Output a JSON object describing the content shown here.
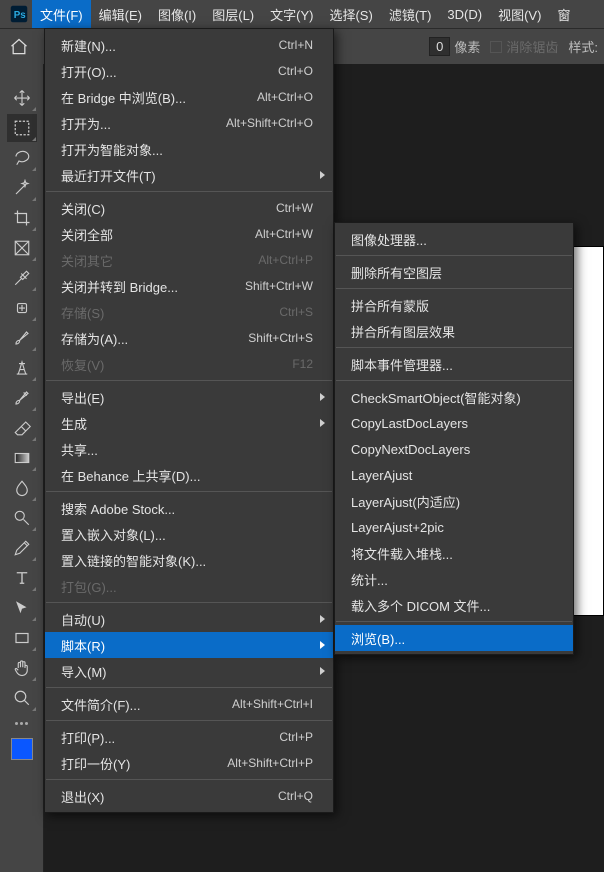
{
  "menubar": {
    "items": [
      "文件(F)",
      "编辑(E)",
      "图像(I)",
      "图层(L)",
      "文字(Y)",
      "选择(S)",
      "滤镜(T)",
      "3D(D)",
      "视图(V)",
      "窗"
    ]
  },
  "optbar": {
    "num": "0",
    "unit": "像素",
    "anti_alias": "消除锯齿",
    "style": "样式:"
  },
  "tools": [
    "move-tool",
    "marquee-tool",
    "lasso-tool",
    "magic-wand-tool",
    "crop-tool",
    "frame-tool",
    "eyedropper-tool",
    "healing-brush-tool",
    "brush-tool",
    "clone-stamp-tool",
    "history-brush-tool",
    "eraser-tool",
    "gradient-tool",
    "blur-tool",
    "dodge-tool",
    "pen-tool",
    "type-tool",
    "path-selection-tool",
    "rectangle-tool",
    "hand-tool",
    "zoom-tool"
  ],
  "swatch_color": "#0a57ff",
  "file_menu": [
    {
      "label": "新建(N)...",
      "shortcut": "Ctrl+N"
    },
    {
      "label": "打开(O)...",
      "shortcut": "Ctrl+O"
    },
    {
      "label": "在 Bridge 中浏览(B)...",
      "shortcut": "Alt+Ctrl+O"
    },
    {
      "label": "打开为...",
      "shortcut": "Alt+Shift+Ctrl+O"
    },
    {
      "label": "打开为智能对象..."
    },
    {
      "label": "最近打开文件(T)",
      "sub": true
    },
    {
      "sep": true
    },
    {
      "label": "关闭(C)",
      "shortcut": "Ctrl+W"
    },
    {
      "label": "关闭全部",
      "shortcut": "Alt+Ctrl+W"
    },
    {
      "label": "关闭其它",
      "shortcut": "Alt+Ctrl+P",
      "disabled": true
    },
    {
      "label": "关闭并转到 Bridge...",
      "shortcut": "Shift+Ctrl+W"
    },
    {
      "label": "存储(S)",
      "shortcut": "Ctrl+S",
      "disabled": true
    },
    {
      "label": "存储为(A)...",
      "shortcut": "Shift+Ctrl+S"
    },
    {
      "label": "恢复(V)",
      "shortcut": "F12",
      "disabled": true
    },
    {
      "sep": true
    },
    {
      "label": "导出(E)",
      "sub": true
    },
    {
      "label": "生成",
      "sub": true
    },
    {
      "label": "共享..."
    },
    {
      "label": "在 Behance 上共享(D)..."
    },
    {
      "sep": true
    },
    {
      "label": "搜索 Adobe Stock..."
    },
    {
      "label": "置入嵌入对象(L)..."
    },
    {
      "label": "置入链接的智能对象(K)..."
    },
    {
      "label": "打包(G)...",
      "disabled": true
    },
    {
      "sep": true
    },
    {
      "label": "自动(U)",
      "sub": true
    },
    {
      "label": "脚本(R)",
      "sub": true,
      "highlight": true
    },
    {
      "label": "导入(M)",
      "sub": true
    },
    {
      "sep": true
    },
    {
      "label": "文件简介(F)...",
      "shortcut": "Alt+Shift+Ctrl+I"
    },
    {
      "sep": true
    },
    {
      "label": "打印(P)...",
      "shortcut": "Ctrl+P"
    },
    {
      "label": "打印一份(Y)",
      "shortcut": "Alt+Shift+Ctrl+P"
    },
    {
      "sep": true
    },
    {
      "label": "退出(X)",
      "shortcut": "Ctrl+Q"
    }
  ],
  "script_menu": [
    {
      "label": "图像处理器..."
    },
    {
      "sep": true
    },
    {
      "label": "删除所有空图层"
    },
    {
      "sep": true
    },
    {
      "label": "拼合所有蒙版"
    },
    {
      "label": "拼合所有图层效果"
    },
    {
      "sep": true
    },
    {
      "label": "脚本事件管理器..."
    },
    {
      "sep": true
    },
    {
      "label": "CheckSmartObject(智能对象)"
    },
    {
      "label": "CopyLastDocLayers"
    },
    {
      "label": "CopyNextDocLayers"
    },
    {
      "label": "LayerAjust"
    },
    {
      "label": "LayerAjust(内适应)"
    },
    {
      "label": "LayerAjust+2pic"
    },
    {
      "label": "将文件载入堆栈..."
    },
    {
      "label": "统计..."
    },
    {
      "label": "载入多个 DICOM 文件..."
    },
    {
      "sep": true
    },
    {
      "label": "浏览(B)...",
      "highlight": true
    }
  ]
}
